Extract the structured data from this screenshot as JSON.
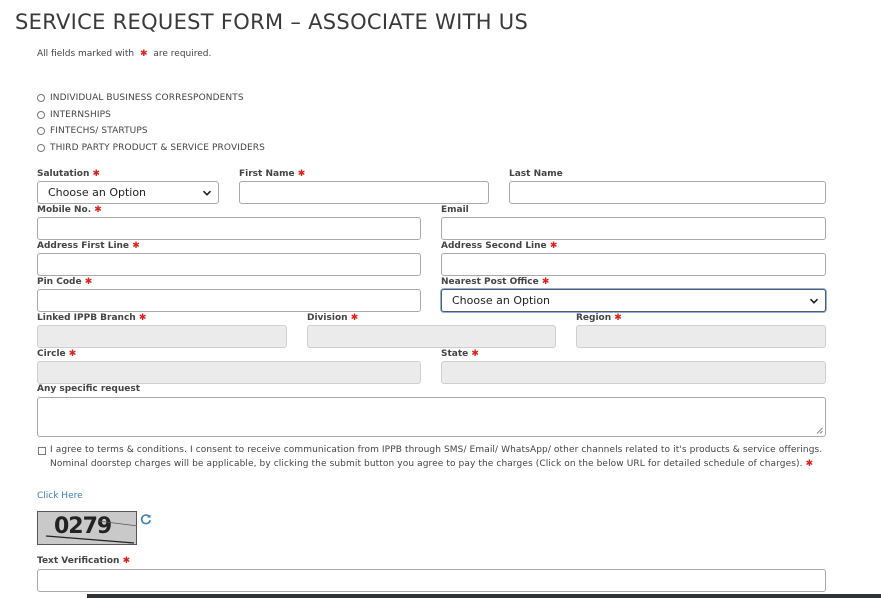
{
  "page": {
    "title": "SERVICE REQUEST FORM – ASSOCIATE WITH US",
    "required_note_before": "All fields marked with",
    "required_note_after": "are required.",
    "required_marker": "✱"
  },
  "options": [
    {
      "label": "INDIVIDUAL BUSINESS CORRESPONDENTS",
      "selected": false
    },
    {
      "label": "INTERNSHIPS",
      "selected": false
    },
    {
      "label": "FINTECHS/ STARTUPS",
      "selected": false
    },
    {
      "label": "THIRD PARTY PRODUCT & SERVICE PROVIDERS",
      "selected": false
    }
  ],
  "fields": {
    "salutation": {
      "label": "Salutation",
      "value": "Choose an Option"
    },
    "first_name": {
      "label": "First Name",
      "value": ""
    },
    "last_name": {
      "label": "Last Name",
      "value": ""
    },
    "mobile": {
      "label": "Mobile No.",
      "value": ""
    },
    "email": {
      "label": "Email",
      "value": ""
    },
    "address1": {
      "label": "Address First Line",
      "value": ""
    },
    "address2": {
      "label": "Address Second Line",
      "value": ""
    },
    "pin": {
      "label": "Pin Code",
      "value": ""
    },
    "post_office": {
      "label": "Nearest Post Office",
      "value": "Choose an Option"
    },
    "ippb_branch": {
      "label": "Linked IPPB Branch",
      "value": ""
    },
    "division": {
      "label": "Division",
      "value": ""
    },
    "region": {
      "label": "Region",
      "value": ""
    },
    "circle": {
      "label": "Circle",
      "value": ""
    },
    "state": {
      "label": "State",
      "value": ""
    },
    "specific_request": {
      "label": "Any specific request",
      "value": ""
    },
    "text_verification": {
      "label": "Text Verification",
      "value": ""
    }
  },
  "agreement": {
    "text": "I agree to terms & conditions. I consent to receive communication from IPPB through SMS/ Email/ WhatsApp/ other channels related to it's products & service offerings. Nominal doorstep charges will be applicable, by clicking the submit button you agree to pay the charges (Click on the below URL for detailed schedule of charges).",
    "checked": false,
    "link_label": "Click Here"
  },
  "captcha": {
    "text": "0279",
    "refresh_icon": "refresh-icon"
  },
  "colors": {
    "required": "#e0201c",
    "link": "#3d7fb5",
    "disabled_field": "#ebebeb"
  }
}
